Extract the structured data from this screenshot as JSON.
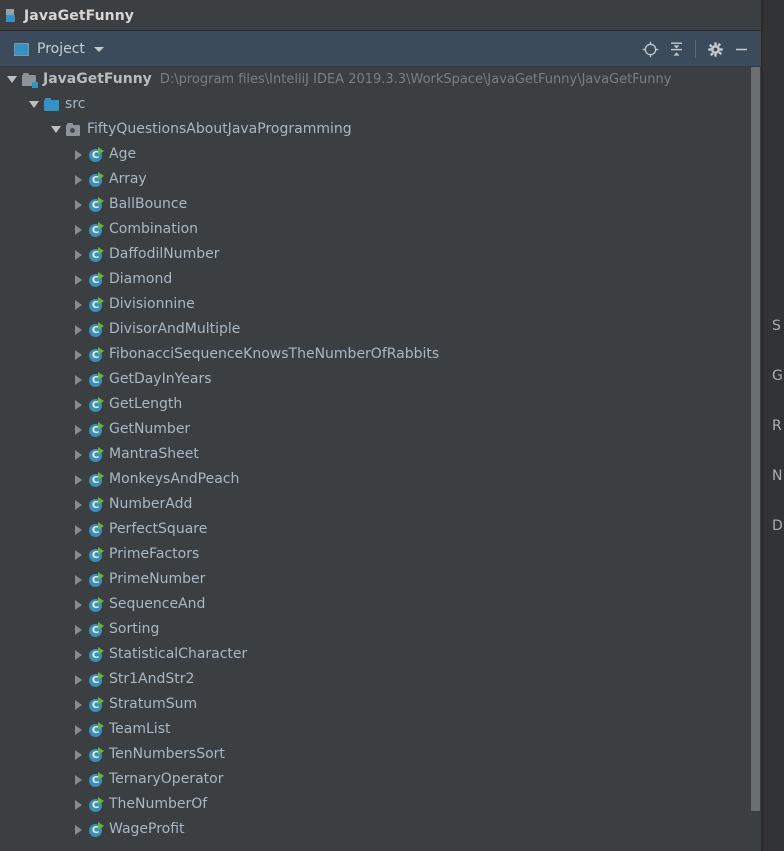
{
  "window": {
    "title": "JavaGetFunny",
    "title_icon": "module-square-icon"
  },
  "toolbar": {
    "tab_label": "Project",
    "tab_icon": "project-view-icon",
    "dropdown_icon": "chevron-down-icon",
    "actions": [
      {
        "name": "select-opened-file-icon",
        "label": "Select Opened File"
      },
      {
        "name": "collapse-all-icon",
        "label": "Collapse All"
      },
      {
        "name": "settings-gear-icon",
        "label": "Settings"
      },
      {
        "name": "hide-icon",
        "label": "Hide"
      }
    ]
  },
  "tree": {
    "nodes": [
      {
        "label": "JavaGetFunny",
        "path": "D:\\program files\\IntelliJ IDEA 2019.3.3\\WorkSpace\\JavaGetFunny\\JavaGetFunny",
        "icon": "module-folder-icon",
        "twisty": "down",
        "depth": 0,
        "style": "bold"
      },
      {
        "label": "src",
        "path": "",
        "icon": "source-root-folder-icon",
        "twisty": "down",
        "depth": 1,
        "style": "plain"
      },
      {
        "label": "FiftyQuestionsAboutJavaProgramming",
        "path": "",
        "icon": "package-folder-icon",
        "twisty": "down",
        "depth": 2,
        "style": "plain"
      },
      {
        "label": "Age",
        "path": "",
        "icon": "java-class-icon",
        "twisty": "right",
        "depth": 3,
        "style": "plain"
      },
      {
        "label": "Array",
        "path": "",
        "icon": "java-class-icon",
        "twisty": "right",
        "depth": 3,
        "style": "plain"
      },
      {
        "label": "BallBounce",
        "path": "",
        "icon": "java-class-icon",
        "twisty": "right",
        "depth": 3,
        "style": "plain"
      },
      {
        "label": "Combination",
        "path": "",
        "icon": "java-class-icon",
        "twisty": "right",
        "depth": 3,
        "style": "plain"
      },
      {
        "label": "DaffodilNumber",
        "path": "",
        "icon": "java-class-icon",
        "twisty": "right",
        "depth": 3,
        "style": "plain"
      },
      {
        "label": "Diamond",
        "path": "",
        "icon": "java-class-icon",
        "twisty": "right",
        "depth": 3,
        "style": "plain"
      },
      {
        "label": "Divisionnine",
        "path": "",
        "icon": "java-class-icon",
        "twisty": "right",
        "depth": 3,
        "style": "plain"
      },
      {
        "label": "DivisorAndMultiple",
        "path": "",
        "icon": "java-class-icon",
        "twisty": "right",
        "depth": 3,
        "style": "plain"
      },
      {
        "label": "FibonacciSequenceKnowsTheNumberOfRabbits",
        "path": "",
        "icon": "java-class-icon",
        "twisty": "right",
        "depth": 3,
        "style": "plain"
      },
      {
        "label": "GetDayInYears",
        "path": "",
        "icon": "java-class-icon",
        "twisty": "right",
        "depth": 3,
        "style": "plain"
      },
      {
        "label": "GetLength",
        "path": "",
        "icon": "java-class-icon",
        "twisty": "right",
        "depth": 3,
        "style": "plain"
      },
      {
        "label": "GetNumber",
        "path": "",
        "icon": "java-class-icon",
        "twisty": "right",
        "depth": 3,
        "style": "plain"
      },
      {
        "label": "MantraSheet",
        "path": "",
        "icon": "java-class-icon",
        "twisty": "right",
        "depth": 3,
        "style": "plain"
      },
      {
        "label": "MonkeysAndPeach",
        "path": "",
        "icon": "java-class-icon",
        "twisty": "right",
        "depth": 3,
        "style": "plain"
      },
      {
        "label": "NumberAdd",
        "path": "",
        "icon": "java-class-icon",
        "twisty": "right",
        "depth": 3,
        "style": "plain"
      },
      {
        "label": "PerfectSquare",
        "path": "",
        "icon": "java-class-icon",
        "twisty": "right",
        "depth": 3,
        "style": "plain"
      },
      {
        "label": "PrimeFactors",
        "path": "",
        "icon": "java-class-icon",
        "twisty": "right",
        "depth": 3,
        "style": "plain"
      },
      {
        "label": "PrimeNumber",
        "path": "",
        "icon": "java-class-icon",
        "twisty": "right",
        "depth": 3,
        "style": "plain"
      },
      {
        "label": "SequenceAnd",
        "path": "",
        "icon": "java-class-icon",
        "twisty": "right",
        "depth": 3,
        "style": "plain"
      },
      {
        "label": "Sorting",
        "path": "",
        "icon": "java-class-icon",
        "twisty": "right",
        "depth": 3,
        "style": "plain"
      },
      {
        "label": "StatisticalCharacter",
        "path": "",
        "icon": "java-class-icon",
        "twisty": "right",
        "depth": 3,
        "style": "plain"
      },
      {
        "label": "Str1AndStr2",
        "path": "",
        "icon": "java-class-icon",
        "twisty": "right",
        "depth": 3,
        "style": "plain"
      },
      {
        "label": "StratumSum",
        "path": "",
        "icon": "java-class-icon",
        "twisty": "right",
        "depth": 3,
        "style": "plain"
      },
      {
        "label": "TeamList",
        "path": "",
        "icon": "java-class-icon",
        "twisty": "right",
        "depth": 3,
        "style": "plain"
      },
      {
        "label": "TenNumbersSort",
        "path": "",
        "icon": "java-class-icon",
        "twisty": "right",
        "depth": 3,
        "style": "plain"
      },
      {
        "label": "TernaryOperator",
        "path": "",
        "icon": "java-class-icon",
        "twisty": "right",
        "depth": 3,
        "style": "plain"
      },
      {
        "label": "TheNumberOf",
        "path": "",
        "icon": "java-class-icon",
        "twisty": "right",
        "depth": 3,
        "style": "plain"
      },
      {
        "label": "WageProfit",
        "path": "",
        "icon": "java-class-icon",
        "twisty": "right",
        "depth": 3,
        "style": "plain"
      }
    ]
  },
  "scrollbar": {
    "orientation": "vertical"
  },
  "background_panel": {
    "clipped_labels": [
      "S",
      "G",
      "R",
      "N",
      "D"
    ]
  }
}
